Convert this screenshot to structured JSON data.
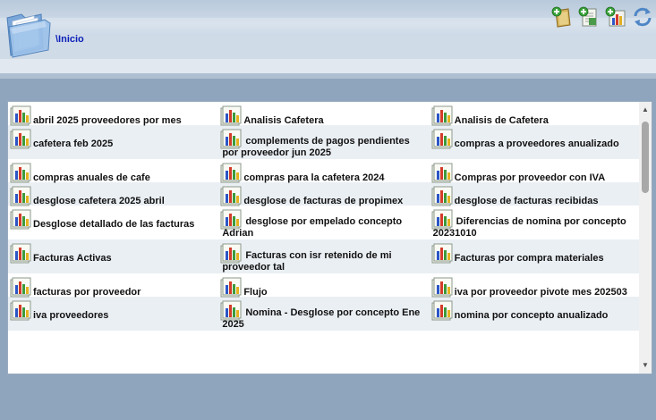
{
  "header": {
    "breadcrumb": "\\Inicio",
    "folder_icon": "open-folder-icon",
    "toolbar": [
      {
        "name": "add-folder-button",
        "icon": "add-folder-icon"
      },
      {
        "name": "add-document-button",
        "icon": "add-document-icon"
      },
      {
        "name": "add-report-button",
        "icon": "add-report-icon"
      },
      {
        "name": "refresh-button",
        "icon": "refresh-icon"
      }
    ]
  },
  "reports": {
    "icon": "bar-chart-report-icon",
    "items": [
      "abril 2025 proveedores por mes",
      "Analisis Cafetera",
      "Analisis de Cafetera",
      "cafetera feb 2025",
      "complements de pagos pendientes por proveedor jun 2025",
      "compras a proveedores anualizado",
      "compras anuales de cafe",
      "compras para la cafetera 2024",
      "Compras por proveedor con IVA",
      "desglose cafetera 2025 abril",
      "desglose de facturas de propimex",
      "desglose de facturas recibidas",
      "Desglose detallado de las facturas",
      "desglose por empelado concepto Adrian",
      "Diferencias de nomina por concepto 20231010",
      "Facturas Activas",
      "Facturas con isr retenido de mi proveedor tal",
      "Facturas por compra materiales",
      "facturas por proveedor",
      "Flujo",
      "iva por proveedor pivote mes 202503",
      "iva proveedores",
      "Nomina - Desglose por concepto Ene 2025",
      "nomina por concepto anualizado"
    ]
  },
  "scrollbar": {
    "up": "▲",
    "down": "▼"
  }
}
